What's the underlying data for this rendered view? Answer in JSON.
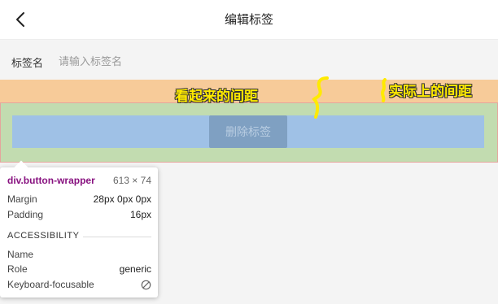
{
  "header": {
    "title": "编辑标签",
    "back_icon": "chevron-left-icon"
  },
  "form": {
    "label": "标签名",
    "placeholder": "请输入标签名",
    "value": ""
  },
  "button": {
    "label": "删除标签"
  },
  "annotations": {
    "apparent": "看起来的间距",
    "actual": "实际上的间距"
  },
  "colors": {
    "margin": "#f7cb99",
    "padding": "#c2dcb0",
    "content": "#9fc1e6",
    "annotation": "#ffea00"
  },
  "tooltip": {
    "element": "div.button-wrapper",
    "size": "613 × 74",
    "margin_label": "Margin",
    "margin_value": "28px 0px 0px",
    "padding_label": "Padding",
    "padding_value": "16px",
    "section": "ACCESSIBILITY",
    "name_label": "Name",
    "name_value": "",
    "role_label": "Role",
    "role_value": "generic",
    "focusable_label": "Keyboard-focusable",
    "focusable_icon": "no-entry-icon"
  }
}
